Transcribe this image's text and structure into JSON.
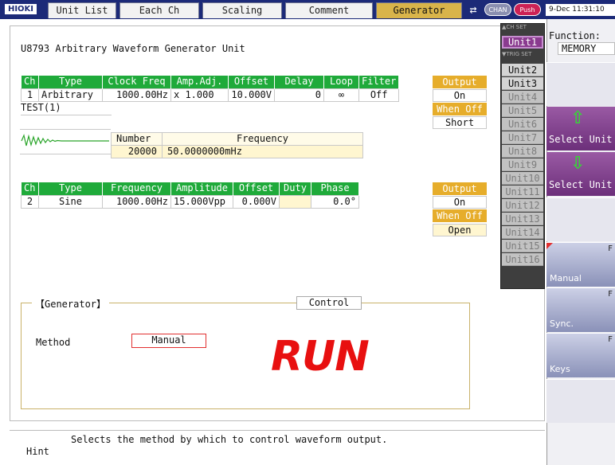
{
  "header": {
    "logo": "HIOKI",
    "tabs": [
      "Unit List",
      "Each Ch",
      "Scaling",
      "Comment",
      "Generator"
    ],
    "active_tab": "Generator",
    "chan_label": "CHAN",
    "push_label": "Push",
    "clock": "9-Dec 11:31:10"
  },
  "main": {
    "unit_title": "U8793  Arbitrary Waveform Generator Unit",
    "ch1": {
      "headers": [
        "Ch",
        "Type",
        "Clock Freq",
        "Amp.Adj.",
        "Offset",
        "Delay",
        "Loop",
        "Filter"
      ],
      "row": [
        "1",
        "Arbitrary",
        "1000.00Hz",
        "x 1.000",
        "10.000V",
        "0",
        "∞",
        "Off"
      ],
      "file_name": "TEST(1)",
      "number_label": "Number",
      "frequency_label": "Frequency",
      "number_value": "20000",
      "frequency_value": "50.0000000mHz",
      "output_label": "Output",
      "output_value": "On",
      "when_off_label": "When Off",
      "when_off_value": "Short"
    },
    "ch2": {
      "headers": [
        "Ch",
        "Type",
        "Frequency",
        "Amplitude",
        "Offset",
        "Duty",
        "Phase"
      ],
      "row": [
        "2",
        "Sine",
        "1000.00Hz",
        "15.000Vpp",
        "0.000V",
        "",
        "0.0°"
      ],
      "output_label": "Output",
      "output_value": "On",
      "when_off_label": "When Off",
      "when_off_value": "Open"
    },
    "generator": {
      "section_title": "【Generator】",
      "control_label": "Control",
      "method_label": "Method",
      "method_value": "Manual",
      "state": "RUN"
    },
    "hint": {
      "label": "Hint",
      "text": "Selects the method by which to control waveform output."
    }
  },
  "unit_popup": {
    "ch_set_tag": "▲CH SET",
    "trig_set_tag": "▼TRIG SET",
    "units": [
      "Unit1",
      "Unit2",
      "Unit3",
      "Unit4",
      "Unit5",
      "Unit6",
      "Unit7",
      "Unit8",
      "Unit9",
      "Unit10",
      "Unit11",
      "Unit12",
      "Unit13",
      "Unit14",
      "Unit15",
      "Unit16"
    ],
    "selected": "Unit1"
  },
  "right_panel": {
    "function_label": "Function:",
    "function_value": "MEMORY",
    "select_up_label": "Select Unit",
    "select_down_label": "Select Unit",
    "fn_buttons": [
      {
        "label": "Manual",
        "key": "F"
      },
      {
        "label": "Sync.",
        "key": "F"
      },
      {
        "label": "Keys",
        "key": "F"
      }
    ]
  },
  "colors": {
    "header_bg": "#1c2a78",
    "table_header_green": "#1faa3a",
    "output_orange": "#e6ad2b",
    "run_red": "#e81010",
    "select_purple": "#8a3b8f"
  }
}
